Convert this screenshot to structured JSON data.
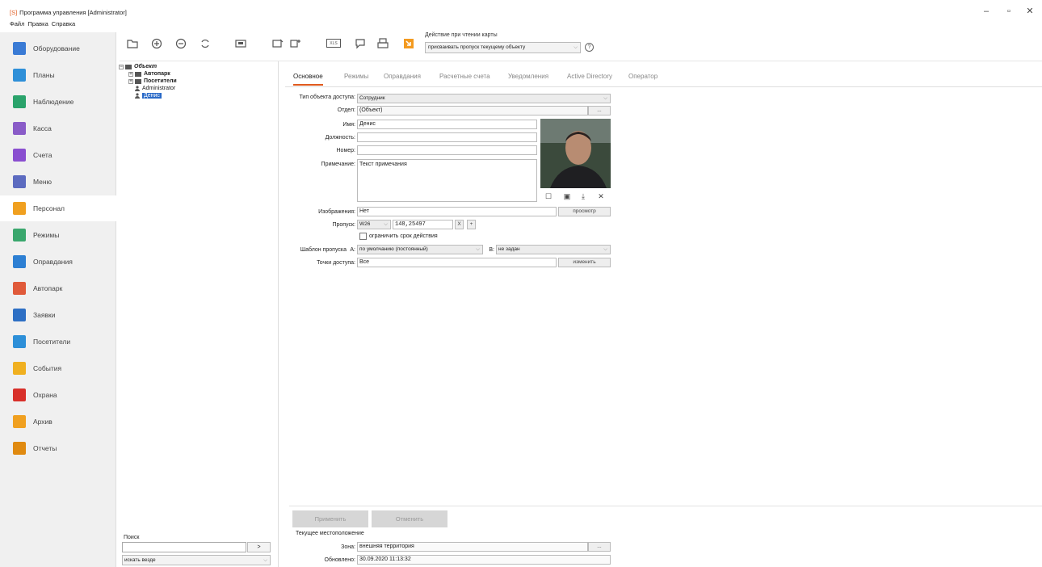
{
  "window": {
    "app_mark": "[S]",
    "title": "Программа управления [Administrator]",
    "controls": [
      "–",
      "▫",
      "✕"
    ]
  },
  "menu": [
    "Файл",
    "Правка",
    "Справка"
  ],
  "toolbar": {
    "card_action_label": "Действие при чтении карты",
    "card_action_value": "присваивать пропуск текущему объекту",
    "help": "?",
    "xls_label": "XLS"
  },
  "nav": [
    {
      "label": "Оборудование",
      "icon": "equipment-icon",
      "color": "#3a7bd5"
    },
    {
      "label": "Планы",
      "icon": "plans-icon",
      "color": "#2e8fd8"
    },
    {
      "label": "Наблюдение",
      "icon": "surveillance-icon",
      "color": "#2aa36b"
    },
    {
      "label": "Касса",
      "icon": "cash-icon",
      "color": "#8a5cc8"
    },
    {
      "label": "Счета",
      "icon": "accounts-icon",
      "color": "#8a4fd0"
    },
    {
      "label": "Меню",
      "icon": "menu-icon",
      "color": "#5c6bc0"
    },
    {
      "label": "Персонал",
      "icon": "personnel-icon",
      "color": "#f0a020"
    },
    {
      "label": "Режимы",
      "icon": "modes-icon",
      "color": "#3aa76d"
    },
    {
      "label": "Оправдания",
      "icon": "excuses-icon",
      "color": "#2d7fd3"
    },
    {
      "label": "Автопарк",
      "icon": "fleet-icon",
      "color": "#e05a3a"
    },
    {
      "label": "Заявки",
      "icon": "requests-icon",
      "color": "#2d6fc4"
    },
    {
      "label": "Посетители",
      "icon": "visitors-icon",
      "color": "#2d8fd8"
    },
    {
      "label": "События",
      "icon": "events-icon",
      "color": "#f0b020"
    },
    {
      "label": "Охрана",
      "icon": "security-icon",
      "color": "#d8302a"
    },
    {
      "label": "Архив",
      "icon": "archive-icon",
      "color": "#f0a020"
    },
    {
      "label": "Отчеты",
      "icon": "reports-icon",
      "color": "#e08a10"
    }
  ],
  "tree": {
    "root": "Объект",
    "items": [
      "Автопарк",
      "Посетители",
      "Administrator",
      "Денис"
    ]
  },
  "search": {
    "label": "Поиск",
    "go": ">",
    "scope": "искать везде"
  },
  "tabs": [
    "Основное",
    "Режимы",
    "Оправдания",
    "Расчетные счета",
    "Уведомления",
    "Active Directory",
    "Оператор"
  ],
  "form": {
    "type_label": "Тип объекта доступа:",
    "type_value": "Сотрудник",
    "dept_label": "Отдел:",
    "dept_value": "(Объект)",
    "name_label": "Имя:",
    "name_value": "Денис",
    "position_label": "Должность:",
    "position_value": "",
    "number_label": "Номер:",
    "number_value": "",
    "note_label": "Примечание:",
    "note_value": "Текст примечания",
    "images_label": "Изображения:",
    "images_value": "Нет",
    "preview_btn": "просмотр",
    "pass_label": "Пропуск:",
    "pass_format": "W26",
    "pass_value": "148,25497",
    "pass_clear": "X",
    "pass_add": "+",
    "limit_label": "ограничить срок действия",
    "template_label": "Шаблон пропуска",
    "template_a": "A:",
    "template_a_value": "по умолчанию (постоянный)",
    "template_b": "B:",
    "template_b_value": "не задан",
    "points_label": "Точки доступа:",
    "points_value": "Все",
    "change_btn": "изменить",
    "ellipsis": "..."
  },
  "actions": {
    "apply": "Применить",
    "cancel": "Отменить"
  },
  "location": {
    "title": "Текущее местоположение",
    "zone_label": "Зона:",
    "zone_value": "внешняя территория",
    "updated_label": "Обновлено:",
    "updated_value": "30.09.2020 11:13:32"
  }
}
